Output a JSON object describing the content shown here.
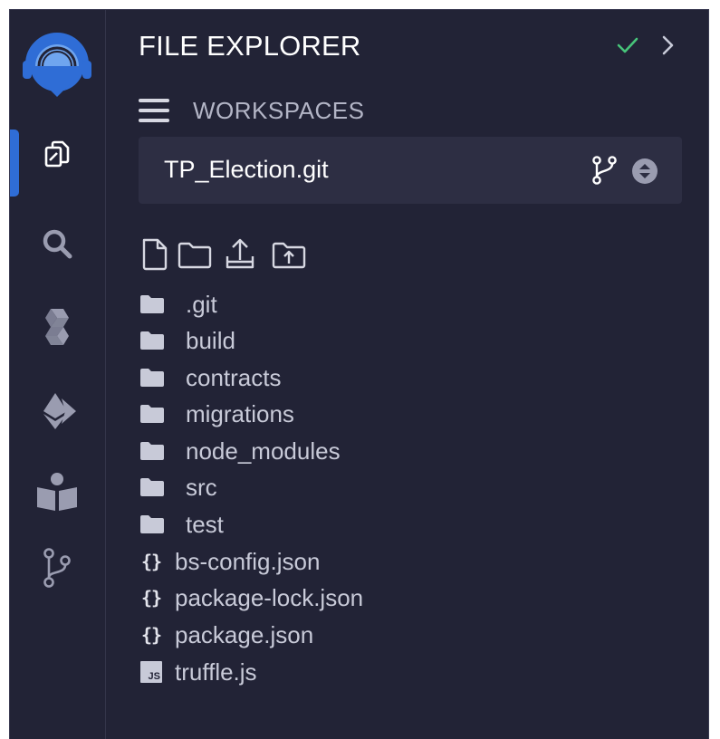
{
  "panel": {
    "title": "FILE EXPLORER"
  },
  "workspaces": {
    "label": "WORKSPACES",
    "current": "TP_Election.git"
  },
  "activity_bar": [
    {
      "name": "file-explorer",
      "icon": "files-icon",
      "active": true
    },
    {
      "name": "search",
      "icon": "search-icon"
    },
    {
      "name": "solidity-compiler",
      "icon": "solidity-icon"
    },
    {
      "name": "deploy-run",
      "icon": "ethereum-icon"
    },
    {
      "name": "learneth",
      "icon": "book-reader-icon"
    },
    {
      "name": "git",
      "icon": "git-branch-icon"
    }
  ],
  "toolbar": [
    "new-file-icon",
    "new-folder-icon",
    "upload-file-icon",
    "upload-folder-icon"
  ],
  "tree": {
    "folders": [
      ".git",
      "build",
      "contracts",
      "migrations",
      "node_modules",
      "src",
      "test"
    ],
    "files": [
      {
        "name": "bs-config.json",
        "icon": "{}"
      },
      {
        "name": "package-lock.json",
        "icon": "{}"
      },
      {
        "name": "package.json",
        "icon": "{}"
      },
      {
        "name": "truffle.js",
        "icon": "JS"
      }
    ]
  },
  "colors": {
    "background": "#222336",
    "accent": "#2f6dd6",
    "success": "#47c47a",
    "text": "#c8cad8"
  }
}
